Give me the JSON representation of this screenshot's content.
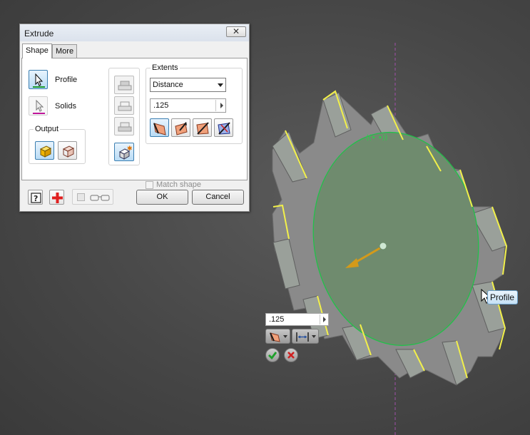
{
  "dialog": {
    "title": "Extrude",
    "close_label": "✕",
    "tabs": [
      {
        "label": "Shape"
      },
      {
        "label": "More"
      }
    ],
    "shape": {
      "profile_label": "Profile",
      "solids_label": "Solids",
      "output_label": "Output"
    },
    "extents": {
      "title": "Extents",
      "mode": "Distance",
      "distance": ".125",
      "match_shape_label": "Match shape"
    },
    "ok_label": "OK",
    "cancel_label": "Cancel",
    "icons": {
      "help": "help-icon",
      "add": "plus-icon",
      "preview": "glasses-icon"
    }
  },
  "mini_toolbar": {
    "distance": ".125"
  },
  "tooltip": {
    "label": "Profile"
  },
  "colors": {
    "viewport": "#4a4a4a",
    "part_face": "#7a9378",
    "selection_highlight": "#f2f04a",
    "profile_edge": "#22c04a",
    "dialog_bg": "#f0f0f0",
    "selected_button": "#b9dcf5",
    "delete_red": "#e02020"
  }
}
